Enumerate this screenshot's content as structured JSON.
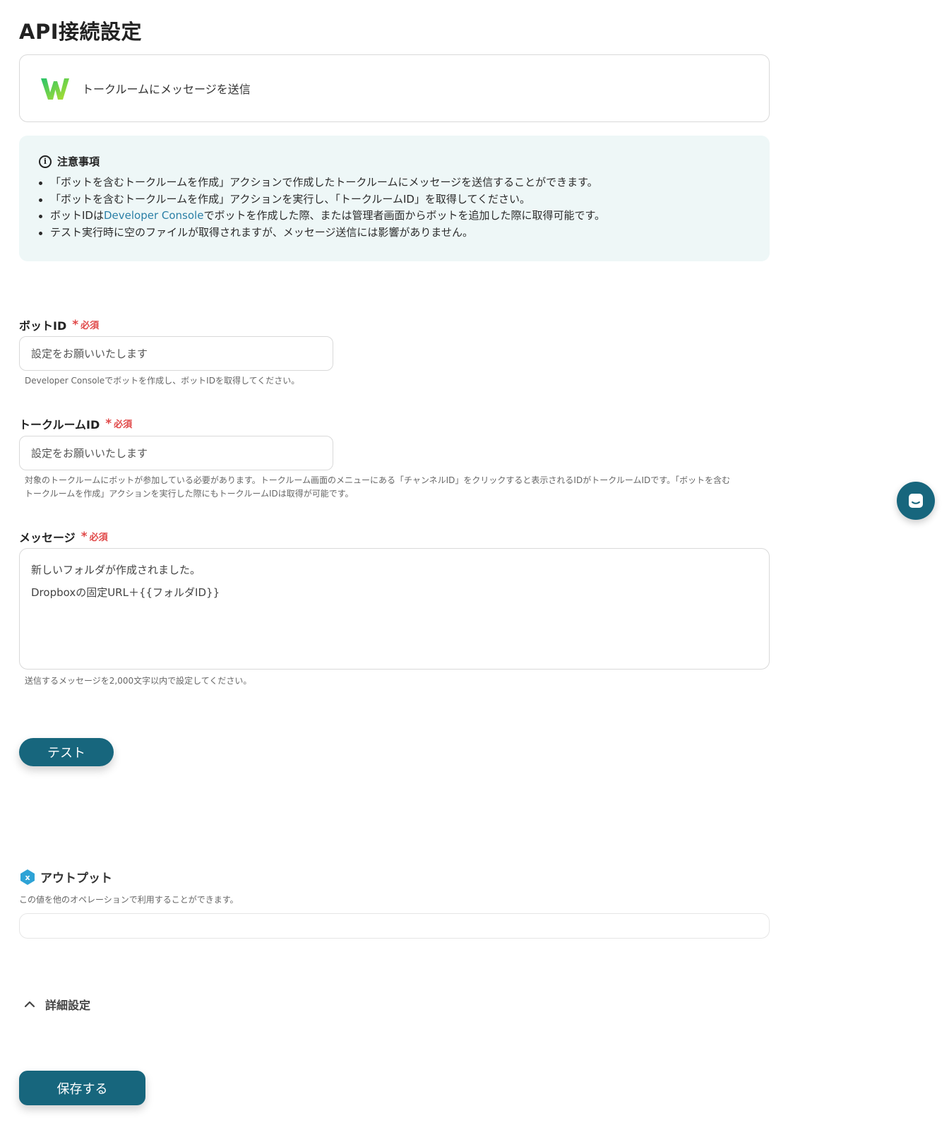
{
  "page": {
    "title": "API接続設定"
  },
  "action": {
    "app_icon": "works-w-logo",
    "label": "トークルームにメッセージを送信"
  },
  "notice": {
    "title": "注意事項",
    "items": [
      "「ボットを含むトークルームを作成」アクションで作成したトークルームにメッセージを送信することができます。",
      "「ボットを含むトークルームを作成」アクションを実行し、「トークルームID」を取得してください。",
      {
        "before": "ボットIDは",
        "link": "Developer Console",
        "after": "でボットを作成した際、または管理者画面からボットを追加した際に取得可能です。"
      },
      "テスト実行時に空のファイルが取得されますが、メッセージ送信には影響がありません。"
    ]
  },
  "required_label": "必須",
  "fields": {
    "bot_id": {
      "label": "ボットID",
      "placeholder": "設定をお願いいたします",
      "hint": "Developer Consoleでボットを作成し、ボットIDを取得してください。"
    },
    "talkroom_id": {
      "label": "トークルームID",
      "placeholder": "設定をお願いいたします",
      "hint_line1": "対象のトークルームにボットが参加している必要があります。トークルーム画面のメニューにある「チャンネルID」をクリックすると表示されるIDがトークルームIDです。「ボットを含む",
      "hint_line2": "トークルームを作成」アクションを実行した際にもトークルームIDは取得が可能です。"
    },
    "message": {
      "label": "メッセージ",
      "line1": "新しいフォルダが作成されました。",
      "line2": "Dropboxの固定URL＋{{フォルダID}}",
      "hint": "送信するメッセージを2,000文字以内で設定してください。"
    }
  },
  "buttons": {
    "test": "テスト",
    "save": "保存する"
  },
  "output": {
    "title": "アウトプット",
    "description": "この値を他のオペレーションで利用することができます。"
  },
  "details": {
    "label": "詳細設定"
  },
  "colors": {
    "primary": "#17667d",
    "required": "#e04848",
    "notice_bg": "#eef7f7",
    "link": "#2a7fa6"
  }
}
